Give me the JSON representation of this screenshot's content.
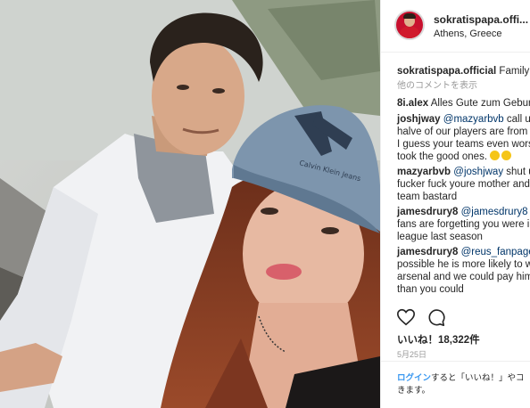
{
  "post": {
    "username": "sokratispapa.offi...",
    "location": "Athens, Greece",
    "likes": "いいね！18,322件",
    "date": "5月25日"
  },
  "comments": {
    "caption_user": "sokratispapa.official",
    "caption_text": "Family ti",
    "load_more": "他のコメントを表示",
    "c1_user": "8i.alex",
    "c1_text": "Alles Gute zum Geburts",
    "c2_user": "joshjway",
    "c2_mention": "@mazyarbvb",
    "c2_text": "call us a",
    "c2_l2": "halve of our players are from y",
    "c2_l3": "I guess your teams even worse",
    "c2_l4": "took the good ones.",
    "c3_user": "mazyarbvb",
    "c3_mention": "@joshjway",
    "c3_text": "shut up",
    "c3_l2": "fucker fuck youre mother and y",
    "c3_l3": "team bastard",
    "c4_user": "jamesdrury8",
    "c4_mention": "@jamesdrury8",
    "c4_text": "u",
    "c4_l2": "fans are forgetting you were in",
    "c4_l3": "league last season",
    "c5_user": "jamesdrury8",
    "c5_mention": "@reus_fanpagee",
    "c5_l2": "possible he is more likely to wi",
    "c5_l3": "arsenal and we could pay him r",
    "c5_l4": "than you could"
  },
  "footer": {
    "login_link": "ログイン",
    "text_1": "すると「いいね！」やコ",
    "text_2": "きます。"
  },
  "photo": {
    "cap_logo": "Calvin Klein Jeans"
  },
  "icons": {
    "like": "heart-icon",
    "comment": "comment-icon",
    "emoji": "laughing-emoji-icon"
  }
}
